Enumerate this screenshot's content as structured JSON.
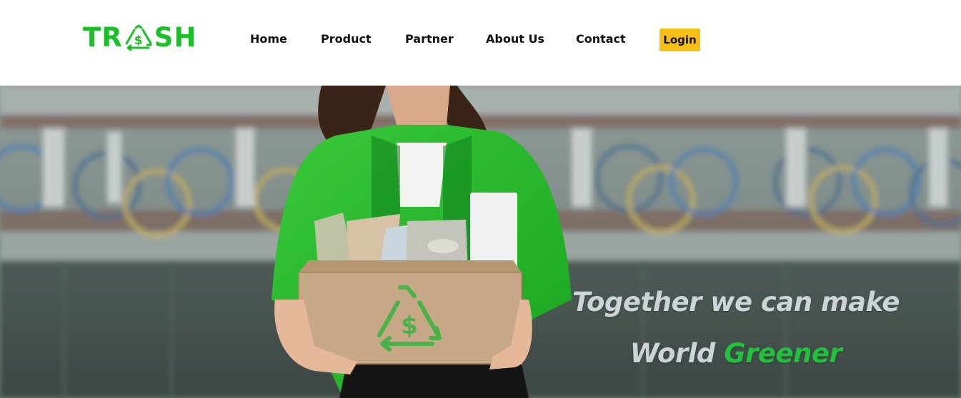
{
  "brand": {
    "logo_prefix": "TR",
    "logo_suffix": "SH",
    "logo_icon": "recycle-dollar-icon",
    "color": "#19c028"
  },
  "nav": {
    "items": [
      {
        "label": "Home"
      },
      {
        "label": "Product"
      },
      {
        "label": "Partner"
      },
      {
        "label": "About Us"
      },
      {
        "label": "Contact"
      }
    ],
    "login_label": "Login",
    "login_color": "#f7be16"
  },
  "hero": {
    "line1": "Together we can make",
    "line2_prefix": "World",
    "line2_highlight": "Greener",
    "highlight_color": "#1fc23a",
    "box_icon": "recycle-dollar-icon"
  }
}
